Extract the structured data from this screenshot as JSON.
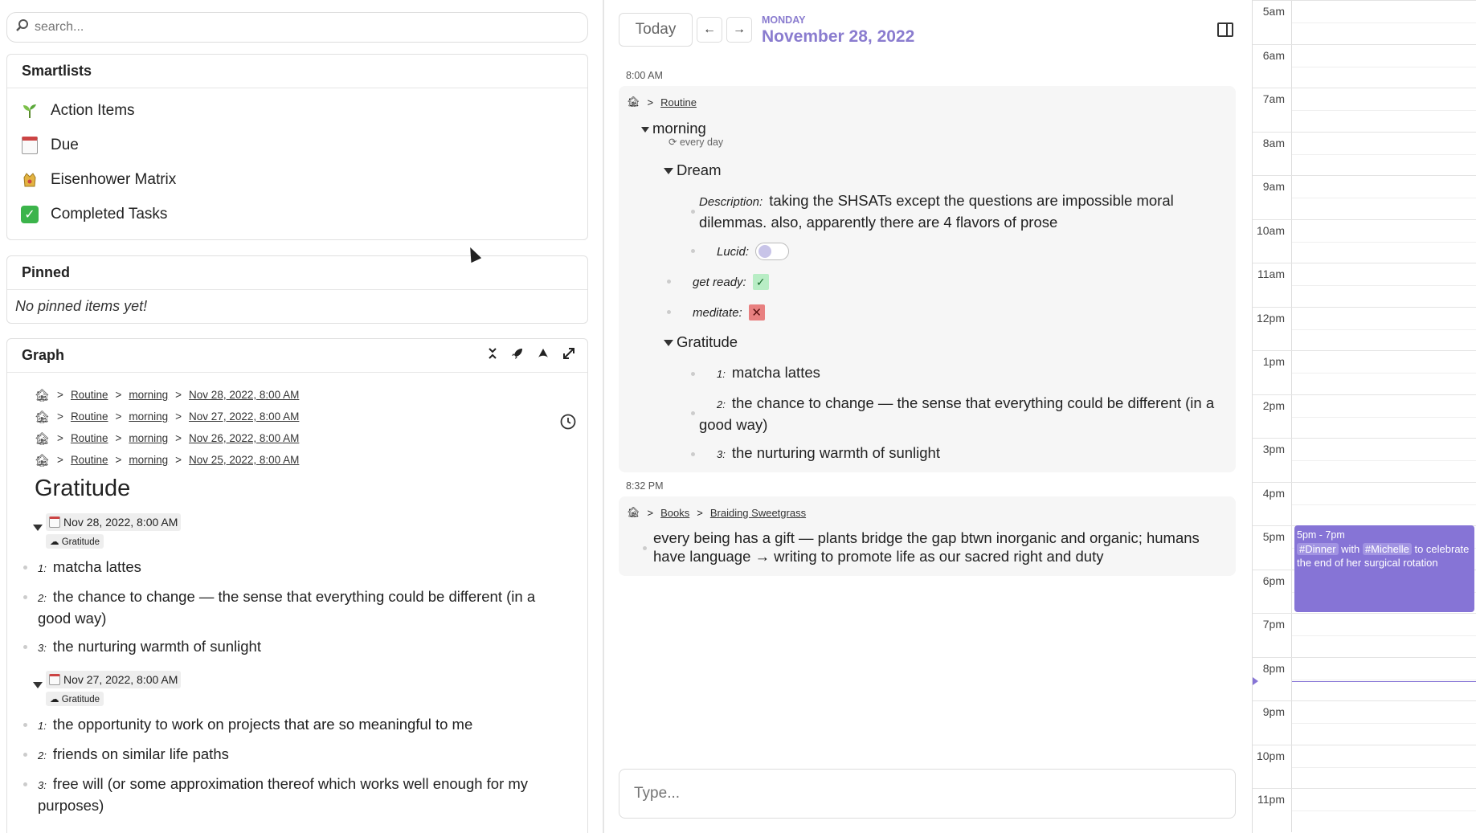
{
  "search": {
    "placeholder": "search..."
  },
  "smartlists": {
    "title": "Smartlists",
    "items": [
      {
        "label": "Action Items",
        "icon": "seedling-icon"
      },
      {
        "label": "Due",
        "icon": "calendar-icon"
      },
      {
        "label": "Eisenhower Matrix",
        "icon": "crown-icon"
      },
      {
        "label": "Completed Tasks",
        "icon": "check-box-icon"
      }
    ]
  },
  "pinned": {
    "title": "Pinned",
    "empty_text": "No pinned items yet!"
  },
  "graph": {
    "title": "Graph",
    "breadcrumbs": [
      {
        "a": "Routine",
        "b": "morning",
        "c": "Nov 28, 2022, 8:00 AM"
      },
      {
        "a": "Routine",
        "b": "morning",
        "c": "Nov 27, 2022, 8:00 AM"
      },
      {
        "a": "Routine",
        "b": "morning",
        "c": "Nov 26, 2022, 8:00 AM"
      },
      {
        "a": "Routine",
        "b": "morning",
        "c": "Nov 25, 2022, 8:00 AM"
      }
    ],
    "heading": "Gratitude",
    "entries": [
      {
        "date": "Nov 28, 2022, 8:00 AM",
        "tag": "Gratitude",
        "items": [
          {
            "n": "1:",
            "text": "matcha lattes"
          },
          {
            "n": "2:",
            "text": "the chance to change — the sense that everything could be different (in a good way)"
          },
          {
            "n": "3:",
            "text": "the nurturing warmth of sunlight"
          }
        ]
      },
      {
        "date": "Nov 27, 2022, 8:00 AM",
        "tag": "Gratitude",
        "items": [
          {
            "n": "1:",
            "text": "the opportunity to work on projects that are so meaningful to me"
          },
          {
            "n": "2:",
            "text": "friends on similar life paths"
          },
          {
            "n": "3:",
            "text": "free will (or some approximation thereof which works well enough for my purposes)"
          }
        ]
      }
    ]
  },
  "day": {
    "today_label": "Today",
    "prev": "←",
    "next": "→",
    "weekday": "MONDAY",
    "date": "November 28, 2022"
  },
  "timeline": {
    "block1": {
      "time": "8:00 AM",
      "crumb": "Routine",
      "title": "morning",
      "recurrence": "every day",
      "dream": {
        "title": "Dream",
        "desc_label": "Description:",
        "desc_text": "taking the SHSATs except the questions are impossible moral dilemmas. also, apparently there are 4 flavors of prose",
        "lucid_label": "Lucid:"
      },
      "get_ready_label": "get ready:",
      "meditate_label": "meditate:",
      "gratitude": {
        "title": "Gratitude",
        "items": [
          {
            "n": "1:",
            "text": "matcha lattes"
          },
          {
            "n": "2:",
            "text": "the chance to change — the sense that everything could be different (in a good way)"
          },
          {
            "n": "3:",
            "text": "the nurturing warmth of sunlight"
          }
        ]
      }
    },
    "block2": {
      "time": "8:32 PM",
      "crumb1": "Books",
      "crumb2": "Braiding Sweetgrass",
      "text": "every being has a gift — plants bridge the gap btwn inorganic and organic; humans have language → writing to promote life as our sacred right and duty"
    }
  },
  "composer": {
    "placeholder": "Type..."
  },
  "calendar": {
    "hours": [
      "5am",
      "6am",
      "7am",
      "8am",
      "9am",
      "10am",
      "11am",
      "12pm",
      "1pm",
      "2pm",
      "3pm",
      "4pm",
      "5pm",
      "6pm",
      "7pm",
      "8pm",
      "9pm",
      "10pm",
      "11pm"
    ],
    "event": {
      "time": "5pm - 7pm",
      "tag1": "#Dinner",
      "with": "with",
      "tag2": "#Michelle",
      "rest": "to celebrate the end of her surgical rotation",
      "color": "#8674d6"
    }
  }
}
